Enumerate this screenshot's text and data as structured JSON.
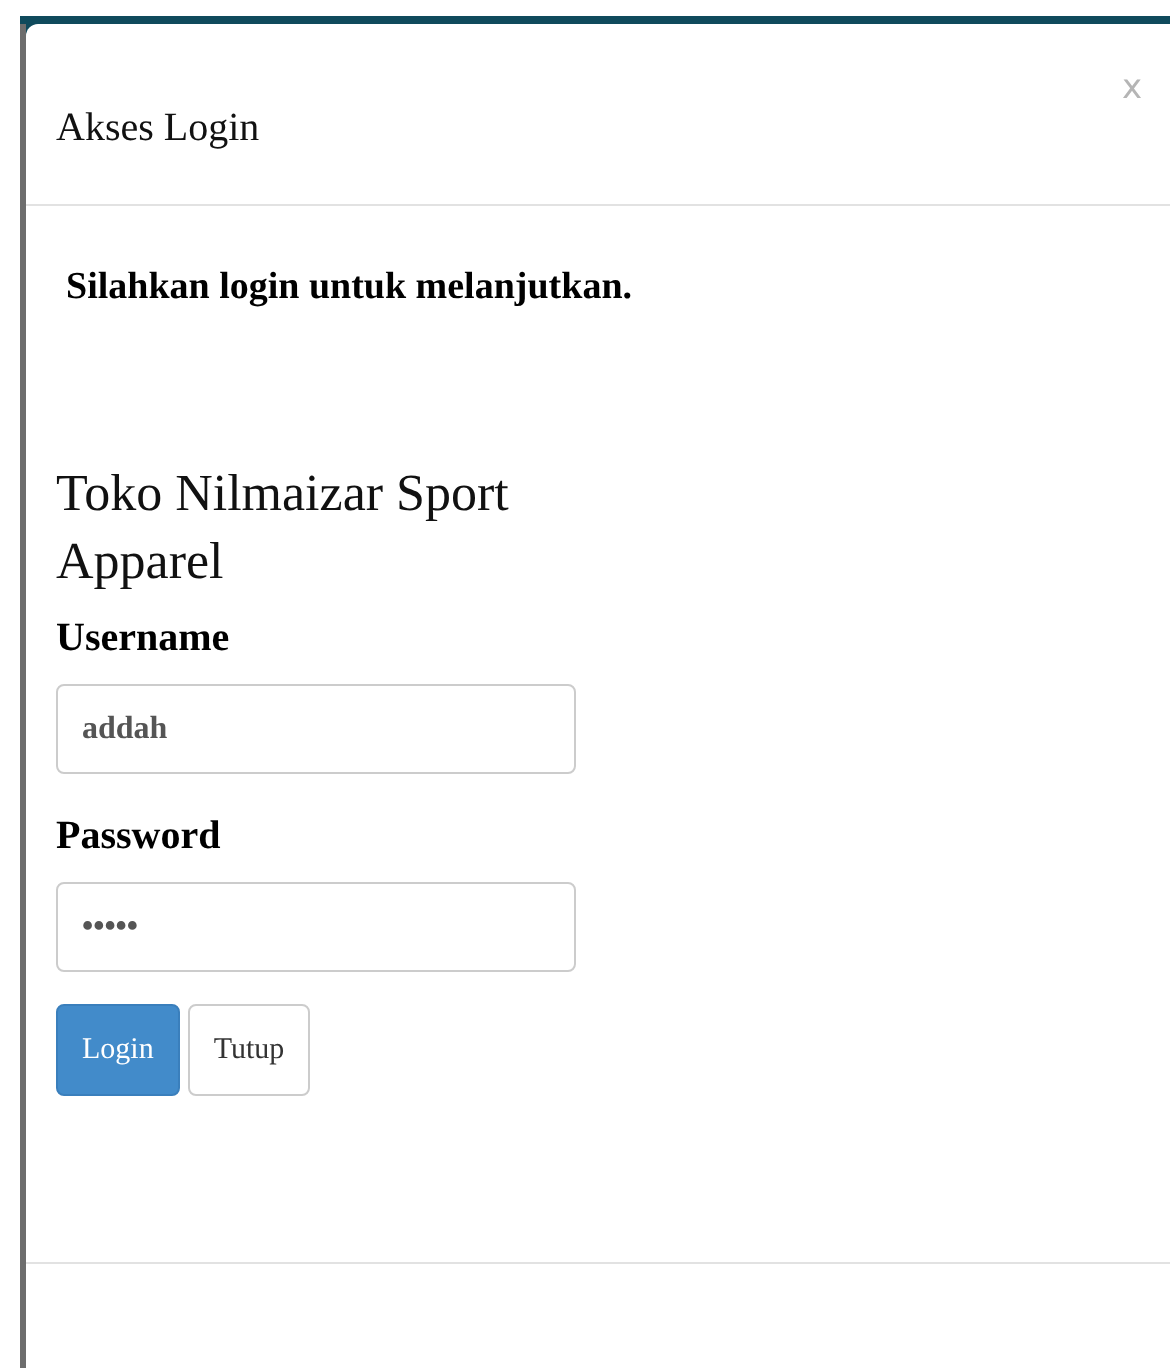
{
  "modal": {
    "title": "Akses Login",
    "close": "x"
  },
  "message": "Silahkan login untuk melanjutkan.",
  "store_name": "Toko Nilmaizar Sport Apparel",
  "fields": [
    {
      "label": "Username",
      "value": "addah"
    },
    {
      "label": "Password",
      "value": "•••••"
    }
  ],
  "buttons": [
    {
      "label": "Login",
      "kind": "primary"
    },
    {
      "label": "Tutup",
      "kind": "default"
    }
  ]
}
